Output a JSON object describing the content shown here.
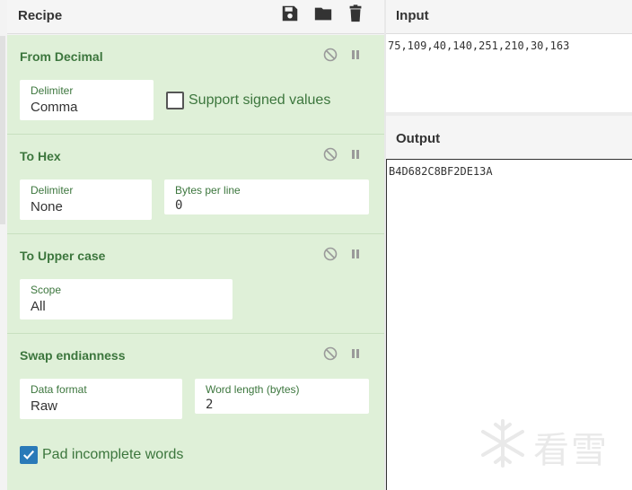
{
  "recipe": {
    "title": "Recipe",
    "icons": [
      "save-icon",
      "folder-icon",
      "trash-icon"
    ],
    "operations": [
      {
        "name": "From Decimal",
        "fields": [
          {
            "label": "Delimiter",
            "value": "Comma"
          }
        ],
        "checkbox": {
          "label": "Support signed values",
          "checked": false
        }
      },
      {
        "name": "To Hex",
        "fields": [
          {
            "label": "Delimiter",
            "value": "None"
          },
          {
            "label": "Bytes per line",
            "value": "0"
          }
        ]
      },
      {
        "name": "To Upper case",
        "fields": [
          {
            "label": "Scope",
            "value": "All"
          }
        ]
      },
      {
        "name": "Swap endianness",
        "fields": [
          {
            "label": "Data format",
            "value": "Raw"
          },
          {
            "label": "Word length (bytes)",
            "value": "2"
          }
        ],
        "checkbox": {
          "label": "Pad incomplete words",
          "checked": true
        }
      }
    ]
  },
  "input": {
    "title": "Input",
    "value": "75,109,40,140,251,210,30,163"
  },
  "output": {
    "title": "Output",
    "value": "B4D682C8BF2DE13A"
  },
  "watermark": {
    "text": "看雪"
  },
  "colors": {
    "op_background": "#dff0d8",
    "op_text": "#3c763d",
    "checkbox_checked": "#2a7ab8"
  }
}
